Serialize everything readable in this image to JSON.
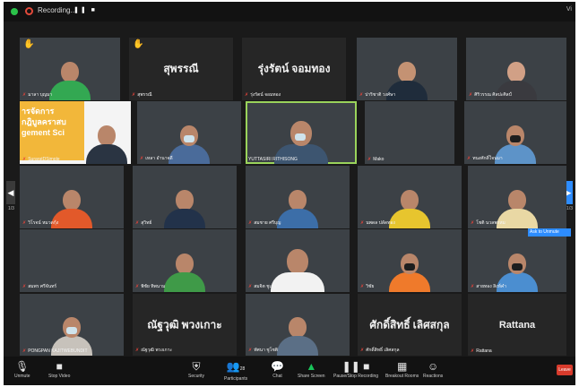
{
  "topbar": {
    "recording_label": "Recording...",
    "recording_controls": "❚❚ ■",
    "view_label": "Vi"
  },
  "tiles": [
    {
      "name": "มาลา บุญมา",
      "big": "",
      "hand": true
    },
    {
      "name": "สุพรรณี",
      "big": "สุพรรณี",
      "hand": true
    },
    {
      "name": "รุ่งรัตน์ จอมทอง",
      "big": "รุ่งรัตน์ จอมทอง",
      "hand": false
    },
    {
      "name": "ปาริชาติ วงศ์ษา",
      "big": "",
      "hand": false
    },
    {
      "name": "ศิริวรรณ ศิลปะศิลป์",
      "big": "",
      "hand": false
    },
    {
      "name": "SuraratDSimple",
      "big": "",
      "hand": false,
      "banner": "ารจัดการ\nกฎิบูลคราสบ\ngement Sci"
    },
    {
      "name": "เหลา อำนาจดี",
      "big": "",
      "hand": false
    },
    {
      "name": "YUTTASIRI RITHISONG",
      "big": "",
      "hand": false
    },
    {
      "name": "Mako",
      "big": "",
      "hand": false
    },
    {
      "name": "ทนงศักดิ์ใจนมา",
      "big": "",
      "hand": false
    },
    {
      "name": "วิโรจน์ หมวดกุ้ง",
      "big": "",
      "hand": false
    },
    {
      "name": "สุวิทย์",
      "big": "",
      "hand": false
    },
    {
      "name": "สมชาย ศรีบุญ",
      "big": "",
      "hand": false
    },
    {
      "name": "นพดล ปลัดทอง",
      "big": "",
      "hand": false
    },
    {
      "name": "โชติ นวลพรหม",
      "big": "",
      "hand": false
    },
    {
      "name": "สมพร ศรีจันทร์",
      "big": "",
      "hand": false
    },
    {
      "name": "พิชัย ทิพนาม",
      "big": "",
      "hand": false
    },
    {
      "name": "สมจิต ชูเกษ",
      "big": "",
      "hand": false
    },
    {
      "name": "วิชัย",
      "big": "",
      "hand": false
    },
    {
      "name": "สายทอง สิงห์คำ",
      "big": "",
      "hand": false
    },
    {
      "name": "PONGPAN KAJITWEBUNDIT",
      "big": "",
      "hand": false
    },
    {
      "name": "ณัฐวุฒิ พวงเกาะ",
      "big": "ณัฐวุฒิ พวงเกาะ",
      "hand": false
    },
    {
      "name": "ทัศนา ชูโชติ",
      "big": "",
      "hand": false
    },
    {
      "name": "ศักดิ์สิทธิ์ เลิศสกุล",
      "big": "ศักดิ์สิทธิ์ เลิศสกุล",
      "hand": false
    },
    {
      "name": "Rattana",
      "big": "Rattana",
      "hand": false
    }
  ],
  "unmute_label": "Ask to Unmute",
  "page_left": "1/3",
  "page_right": "1/3",
  "toolbar": {
    "unmute": "Unmute",
    "stop_video": "Stop Video",
    "security": "Security",
    "participants": "Participants",
    "participants_count": "28",
    "chat": "Chat",
    "share_screen": "Share Screen",
    "recording": "Pause/Stop Recording",
    "breakout": "Breakout Rooms",
    "reactions": "Reactions",
    "leave": "Leave"
  },
  "colors": {
    "accent_green": "#19c45a",
    "active_speaker": "#9ad35b",
    "zoom_blue": "#2d8cff",
    "leave_red": "#d83b2c"
  }
}
